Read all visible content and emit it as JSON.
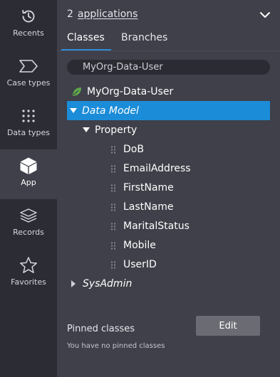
{
  "nav": {
    "items": [
      {
        "label": "Recents",
        "icon": "clock-history-icon"
      },
      {
        "label": "Case types",
        "icon": "case-type-tag-icon"
      },
      {
        "label": "Data types",
        "icon": "grid-dots-icon"
      },
      {
        "label": "App",
        "icon": "cube-icon",
        "active": true
      },
      {
        "label": "Records",
        "icon": "stacked-layers-icon"
      },
      {
        "label": "Favorites",
        "icon": "star-icon"
      }
    ]
  },
  "header": {
    "app_count": "2",
    "app_link": "applications"
  },
  "tabs": [
    {
      "label": "Classes",
      "active": true
    },
    {
      "label": "Branches",
      "active": false
    }
  ],
  "search": {
    "value": "MyOrg-Data-User"
  },
  "tree": {
    "root": "MyOrg-Data-User",
    "data_model": "Data Model",
    "property": "Property",
    "properties": [
      "DoB",
      "EmailAddress",
      "FirstName",
      "LastName",
      "MaritalStatus",
      "Mobile",
      "UserID"
    ],
    "sysadmin": "SysAdmin"
  },
  "pinned": {
    "title": "Pinned classes",
    "empty_text": "You have no pinned classes",
    "edit_label": "Edit"
  },
  "colors": {
    "selected_row": "#1b8cd8",
    "tab_underline": "#2e8bd6",
    "leaf_green": "#5fa84a"
  }
}
